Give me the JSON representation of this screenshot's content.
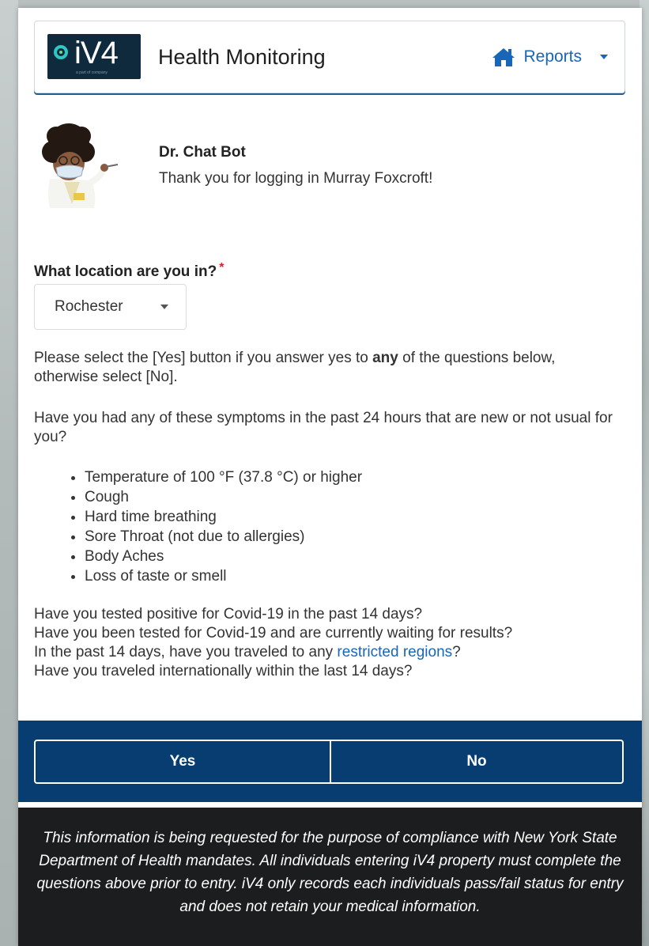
{
  "header": {
    "logo_text": "iV4",
    "logo_tagline": "a part of company",
    "title": "Health Monitoring",
    "reports_label": "Reports"
  },
  "bot": {
    "name": "Dr. Chat Bot",
    "message": "Thank you for logging in Murray Foxcroft!"
  },
  "location": {
    "label": "What location are you in?",
    "required_marker": "*",
    "selected": "Rochester"
  },
  "instructions": {
    "part1": "Please select the [Yes] button if you answer yes to ",
    "emphasis": "any",
    "part2": " of the questions below, otherwise select [No]."
  },
  "symptoms_question": "Have you had any of these symptoms in the past 24 hours that are new or not usual for you?",
  "symptoms": [
    "Temperature of 100 °F (37.8 °C) or higher",
    "Cough",
    "Hard time breathing",
    "Sore Throat (not due to allergies)",
    "Body Aches",
    "Loss of taste or smell"
  ],
  "questions": {
    "q_positive": "Have you tested positive for Covid-19 in the past 14 days?",
    "q_waiting": "Have you been tested for Covid-19 and are currently waiting for results?",
    "q_travel_prefix": "In the past 14 days, have you traveled to any ",
    "q_travel_link": "restricted regions",
    "q_travel_suffix": "?",
    "q_international": "Have you traveled internationally within the last 14 days?"
  },
  "buttons": {
    "yes": "Yes",
    "no": "No"
  },
  "disclaimer": "This information is being requested for the purpose of compliance with New York State Department of Health mandates. All individuals entering iV4 property must complete the questions above prior to entry. iV4 only records each individuals pass/fail status for entry and does not retain your medical information.",
  "colors": {
    "primary": "#083d72",
    "link": "#1866b8",
    "footer": "#1c1d1f",
    "required": "#d0262d"
  },
  "icons": {
    "home": "home-icon",
    "dropdown": "chevron-down-icon"
  }
}
